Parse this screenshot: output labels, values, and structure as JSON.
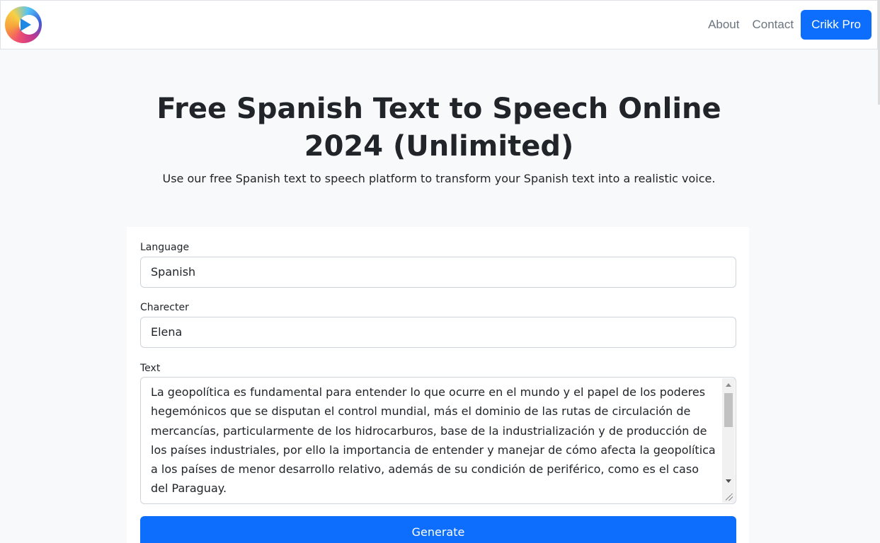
{
  "nav": {
    "logo_icon": "crikk-logo-icon",
    "links": [
      {
        "label": "About"
      },
      {
        "label": "Contact"
      }
    ],
    "pro_button": "Crikk Pro"
  },
  "hero": {
    "title": "Free Spanish Text to Speech Online 2024 (Unlimited)",
    "subtitle": "Use our free Spanish text to speech platform to transform your Spanish text into a realistic voice."
  },
  "form": {
    "language": {
      "label": "Language",
      "value": "Spanish"
    },
    "character": {
      "label": "Charecter",
      "value": "Elena"
    },
    "text": {
      "label": "Text",
      "value": "La geopolítica es fundamental para entender lo que ocurre en el mundo y el papel de los poderes hegemónicos que se disputan el control mundial, más el dominio de las rutas de circulación de mercancías, particularmente de los hidrocarburos, base de la industrialización y de producción de los países industriales, por ello la importancia de entender y manejar de cómo afecta la geopolítica a los países de menor desarrollo relativo, además de su condición de periférico, como es el caso del Paraguay."
    },
    "generate_button": "Generate"
  },
  "colors": {
    "primary": "#0d6efd",
    "background": "#f8f9fa",
    "text": "#212529",
    "muted": "#6c757d"
  }
}
